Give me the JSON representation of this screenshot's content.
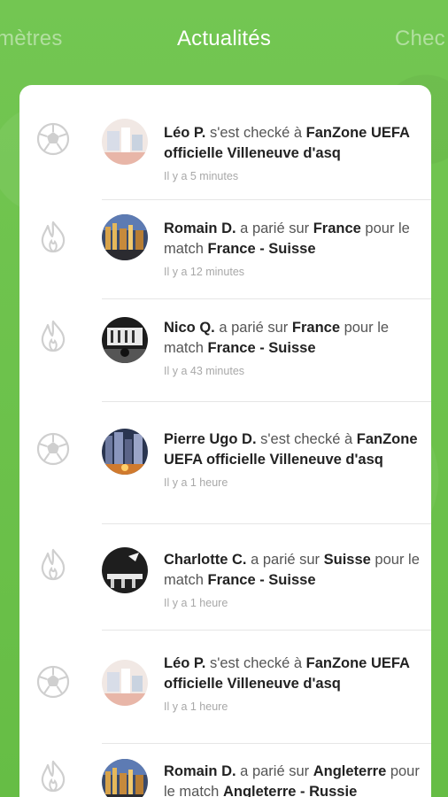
{
  "tabs": {
    "left": "mètres",
    "center": "Actualités",
    "right": "Chec"
  },
  "feed": [
    {
      "kind_icon": "soccer-ball-icon",
      "user": "Léo P.",
      "action": " s'est checké à ",
      "target": "FanZone UEFA officielle Villeneuve d'asq",
      "time": "Il y a 5 minutes"
    },
    {
      "kind_icon": "flame-icon",
      "user": "Romain D.",
      "action": " a parié sur ",
      "target": "France",
      "mid": " pour le match ",
      "match": "France - Suisse",
      "time": "Il y a 12 minutes"
    },
    {
      "kind_icon": "flame-icon",
      "user": "Nico Q.",
      "action": " a parié sur ",
      "target": "France",
      "mid": " pour le match ",
      "match": "France - Suisse",
      "time": "Il y a 43  minutes"
    },
    {
      "kind_icon": "soccer-ball-icon",
      "user": "Pierre Ugo D.",
      "action": " s'est checké à ",
      "target": "FanZone UEFA officielle Villeneuve d'asq",
      "time": "Il y a 1 heure"
    },
    {
      "kind_icon": "flame-icon",
      "user": "Charlotte C.",
      "action": " a parié sur ",
      "target": "Suisse",
      "mid": " pour le match ",
      "match": "France - Suisse",
      "time": "Il y a 1 heure"
    },
    {
      "kind_icon": "soccer-ball-icon",
      "user": "Léo P.",
      "action": " s'est checké à ",
      "target": "FanZone UEFA officielle Villeneuve d'asq",
      "time": "Il y a 1 heure"
    },
    {
      "kind_icon": "flame-icon",
      "user": "Romain D.",
      "action": " a parié sur ",
      "target": "Angleterre",
      "mid": " pour le match ",
      "match": "Angleterre - Russie",
      "time": ""
    }
  ]
}
